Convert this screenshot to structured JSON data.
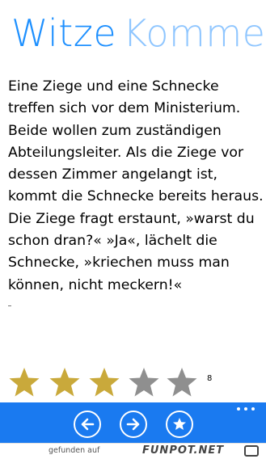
{
  "pivot": {
    "active_title": "Witze",
    "next_title": "Kommentare"
  },
  "joke": {
    "text": "Eine Ziege und eine Schnecke treffen sich vor dem Ministerium. Beide wollen zum zuständigen Abteilungsleiter. Als die Ziege vor dessen Zimmer angelangt ist, kommt die Schnecke bereits heraus. Die Ziege fragt erstaunt, »warst du schon dran?« »Ja«, lächelt die Schnecke, »kriechen muss man können, nicht meckern!«"
  },
  "rating": {
    "value": 3,
    "max": 5,
    "count": "8",
    "filled_color": "#c9a93b",
    "empty_color": "#8f8f8f"
  },
  "app_bar": {
    "background": "#1a7af0",
    "buttons": [
      {
        "name": "previous-button",
        "icon": "arrow-left-icon"
      },
      {
        "name": "next-button",
        "icon": "arrow-right-icon"
      },
      {
        "name": "rate-button",
        "icon": "star-plus-icon"
      }
    ],
    "more_icon": "ellipsis-icon"
  },
  "watermark": {
    "prefix": "gefunden auf",
    "brand": "FUNPOT.NET"
  }
}
